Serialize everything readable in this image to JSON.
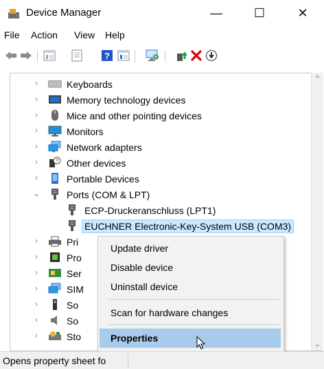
{
  "window": {
    "title": "Device Manager",
    "minimize": "—",
    "maximize": "☐",
    "close": "✕"
  },
  "menu": [
    "File",
    "Action",
    "View",
    "Help"
  ],
  "toolbar_icons": [
    "back-icon",
    "forward-icon",
    "tree-view-icon",
    "properties-icon",
    "help-icon",
    "details-icon",
    "scan-monitor-icon",
    "update-driver-icon",
    "uninstall-icon",
    "disable-icon"
  ],
  "tree": [
    {
      "label": "Keyboards",
      "expander": "›",
      "icon": "keyboard-icon"
    },
    {
      "label": "Memory technology devices",
      "expander": "›",
      "icon": "memory-icon"
    },
    {
      "label": "Mice and other pointing devices",
      "expander": "›",
      "icon": "mouse-icon"
    },
    {
      "label": "Monitors",
      "expander": "›",
      "icon": "monitor-icon"
    },
    {
      "label": "Network adapters",
      "expander": "›",
      "icon": "network-icon"
    },
    {
      "label": "Other devices",
      "expander": "›",
      "icon": "other-devices-icon"
    },
    {
      "label": "Portable Devices",
      "expander": "›",
      "icon": "portable-device-icon"
    },
    {
      "label": "Ports (COM & LPT)",
      "expander": "⌄",
      "icon": "port-icon"
    },
    {
      "label": "ECP-Druckeranschluss (LPT1)",
      "expander": "",
      "icon": "port-icon"
    },
    {
      "label": "EUCHNER Electronic-Key-System USB (COM3)",
      "expander": "",
      "icon": "port-icon"
    },
    {
      "label": "Pri",
      "expander": "›",
      "icon": "printer-icon"
    },
    {
      "label": "Pro",
      "expander": "›",
      "icon": "processor-icon"
    },
    {
      "label": "Ser",
      "expander": "›",
      "icon": "security-icon"
    },
    {
      "label": "SIM",
      "expander": "›",
      "icon": "sim-icon"
    },
    {
      "label": "So",
      "expander": "›",
      "icon": "software-icon"
    },
    {
      "label": "So",
      "expander": "›",
      "icon": "sound-icon"
    },
    {
      "label": "Sto",
      "expander": "›",
      "icon": "storage-icon"
    }
  ],
  "context_menu": {
    "update_driver": "Update driver",
    "disable_device": "Disable device",
    "uninstall_device": "Uninstall device",
    "scan_changes": "Scan for hardware changes",
    "properties": "Properties"
  },
  "status": {
    "text": "Opens property sheet fo"
  },
  "colors": {
    "selection": "#cce8ff",
    "menu_highlight": "#a9cbeb",
    "uninstall_red": "#d40000",
    "accent_blue": "#1e6fd9"
  }
}
